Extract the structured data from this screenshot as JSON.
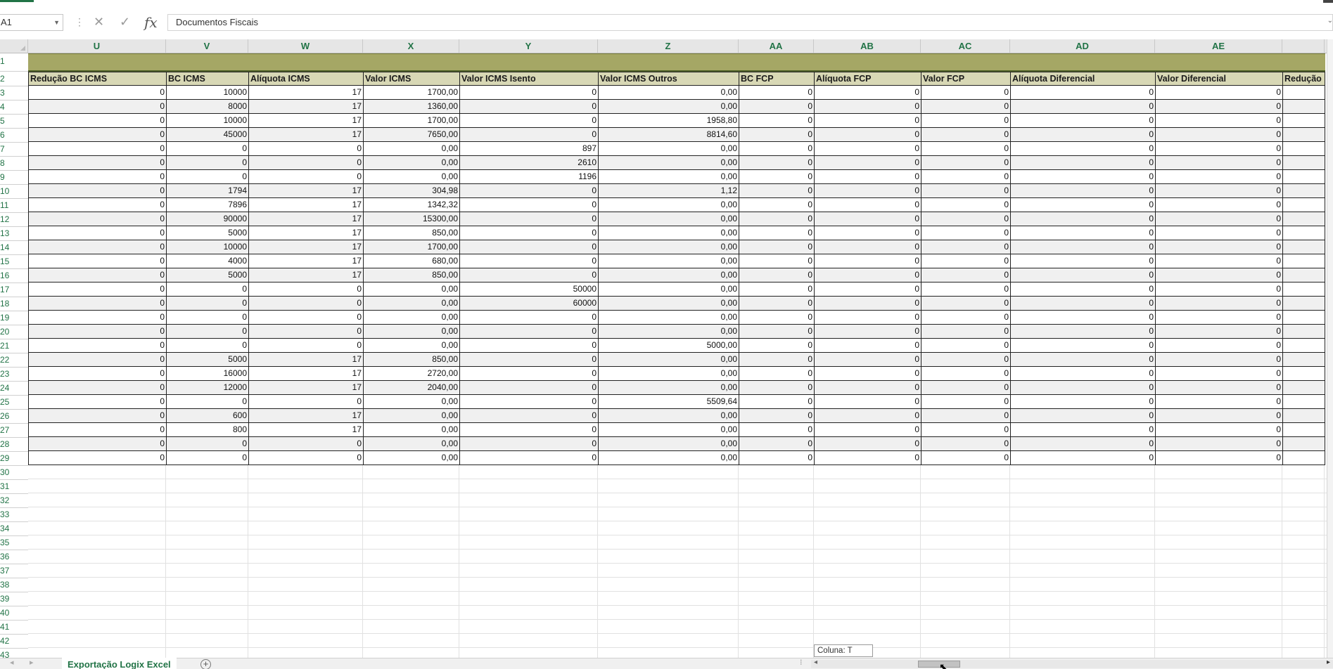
{
  "namebox": {
    "value": "A1"
  },
  "formula_bar": {
    "value": "Documentos Fiscais",
    "fx_label": "fx"
  },
  "columns": [
    "U",
    "V",
    "W",
    "X",
    "Y",
    "Z",
    "AA",
    "AB",
    "AC",
    "AD",
    "AE"
  ],
  "row_numbers": [
    "1",
    "2",
    "3",
    "4",
    "5",
    "6",
    "7",
    "8",
    "9",
    "10",
    "11",
    "12",
    "13",
    "14",
    "15",
    "16",
    "17",
    "18",
    "19",
    "20",
    "21",
    "22",
    "23",
    "24",
    "25",
    "26",
    "27",
    "28",
    "29",
    "30",
    "31",
    "32",
    "33",
    "34",
    "35",
    "36",
    "37",
    "38",
    "39",
    "40",
    "41",
    "42",
    "43"
  ],
  "table": {
    "headers": [
      "Redução BC ICMS",
      "BC ICMS",
      "Alíquota ICMS",
      "Valor ICMS",
      "Valor ICMS Isento",
      "Valor ICMS Outros",
      "BC FCP",
      "Alíquota FCP",
      "Valor FCP",
      "Alíquota Diferencial",
      "Valor Diferencial",
      "Redução"
    ],
    "rows": [
      [
        "0",
        "10000",
        "17",
        "1700,00",
        "0",
        "0,00",
        "0",
        "0",
        "0",
        "0",
        "0",
        ""
      ],
      [
        "0",
        "8000",
        "17",
        "1360,00",
        "0",
        "0,00",
        "0",
        "0",
        "0",
        "0",
        "0",
        ""
      ],
      [
        "0",
        "10000",
        "17",
        "1700,00",
        "0",
        "1958,80",
        "0",
        "0",
        "0",
        "0",
        "0",
        ""
      ],
      [
        "0",
        "45000",
        "17",
        "7650,00",
        "0",
        "8814,60",
        "0",
        "0",
        "0",
        "0",
        "0",
        ""
      ],
      [
        "0",
        "0",
        "0",
        "0,00",
        "897",
        "0,00",
        "0",
        "0",
        "0",
        "0",
        "0",
        ""
      ],
      [
        "0",
        "0",
        "0",
        "0,00",
        "2610",
        "0,00",
        "0",
        "0",
        "0",
        "0",
        "0",
        ""
      ],
      [
        "0",
        "0",
        "0",
        "0,00",
        "1196",
        "0,00",
        "0",
        "0",
        "0",
        "0",
        "0",
        ""
      ],
      [
        "0",
        "1794",
        "17",
        "304,98",
        "0",
        "1,12",
        "0",
        "0",
        "0",
        "0",
        "0",
        ""
      ],
      [
        "0",
        "7896",
        "17",
        "1342,32",
        "0",
        "0,00",
        "0",
        "0",
        "0",
        "0",
        "0",
        ""
      ],
      [
        "0",
        "90000",
        "17",
        "15300,00",
        "0",
        "0,00",
        "0",
        "0",
        "0",
        "0",
        "0",
        ""
      ],
      [
        "0",
        "5000",
        "17",
        "850,00",
        "0",
        "0,00",
        "0",
        "0",
        "0",
        "0",
        "0",
        ""
      ],
      [
        "0",
        "10000",
        "17",
        "1700,00",
        "0",
        "0,00",
        "0",
        "0",
        "0",
        "0",
        "0",
        ""
      ],
      [
        "0",
        "4000",
        "17",
        "680,00",
        "0",
        "0,00",
        "0",
        "0",
        "0",
        "0",
        "0",
        ""
      ],
      [
        "0",
        "5000",
        "17",
        "850,00",
        "0",
        "0,00",
        "0",
        "0",
        "0",
        "0",
        "0",
        ""
      ],
      [
        "0",
        "0",
        "0",
        "0,00",
        "50000",
        "0,00",
        "0",
        "0",
        "0",
        "0",
        "0",
        ""
      ],
      [
        "0",
        "0",
        "0",
        "0,00",
        "60000",
        "0,00",
        "0",
        "0",
        "0",
        "0",
        "0",
        ""
      ],
      [
        "0",
        "0",
        "0",
        "0,00",
        "0",
        "0,00",
        "0",
        "0",
        "0",
        "0",
        "0",
        ""
      ],
      [
        "0",
        "0",
        "0",
        "0,00",
        "0",
        "0,00",
        "0",
        "0",
        "0",
        "0",
        "0",
        ""
      ],
      [
        "0",
        "0",
        "0",
        "0,00",
        "0",
        "5000,00",
        "0",
        "0",
        "0",
        "0",
        "0",
        ""
      ],
      [
        "0",
        "5000",
        "17",
        "850,00",
        "0",
        "0,00",
        "0",
        "0",
        "0",
        "0",
        "0",
        ""
      ],
      [
        "0",
        "16000",
        "17",
        "2720,00",
        "0",
        "0,00",
        "0",
        "0",
        "0",
        "0",
        "0",
        ""
      ],
      [
        "0",
        "12000",
        "17",
        "2040,00",
        "0",
        "0,00",
        "0",
        "0",
        "0",
        "0",
        "0",
        ""
      ],
      [
        "0",
        "0",
        "0",
        "0,00",
        "0",
        "5509,64",
        "0",
        "0",
        "0",
        "0",
        "0",
        ""
      ],
      [
        "0",
        "600",
        "17",
        "0,00",
        "0",
        "0,00",
        "0",
        "0",
        "0",
        "0",
        "0",
        ""
      ],
      [
        "0",
        "800",
        "17",
        "0,00",
        "0",
        "0,00",
        "0",
        "0",
        "0",
        "0",
        "0",
        ""
      ],
      [
        "0",
        "0",
        "0",
        "0,00",
        "0",
        "0,00",
        "0",
        "0",
        "0",
        "0",
        "0",
        ""
      ],
      [
        "0",
        "0",
        "0",
        "0,00",
        "0",
        "0,00",
        "0",
        "0",
        "0",
        "0",
        "0",
        ""
      ]
    ]
  },
  "tooltip": {
    "text": "Coluna: T"
  },
  "sheet_tabs": [
    {
      "label": "Exportação Logix Excel",
      "active": true
    }
  ],
  "colors": {
    "accent": "#217346",
    "banner": "#a5a765",
    "header_fill": "#d8d8b5"
  }
}
